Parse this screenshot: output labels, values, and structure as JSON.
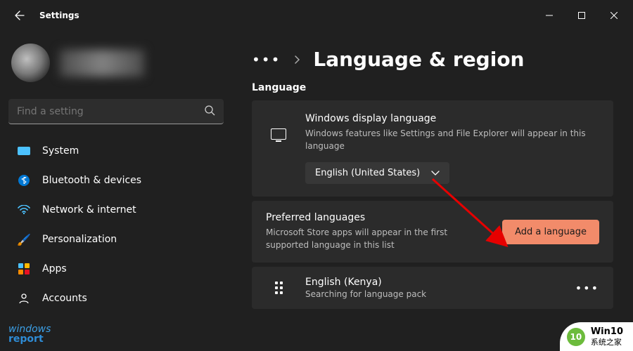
{
  "app_title": "Settings",
  "window_controls": {
    "min": "minimize",
    "max": "maximize",
    "close": "close"
  },
  "search": {
    "placeholder": "Find a setting"
  },
  "nav_items": [
    {
      "icon": "system",
      "label": "System"
    },
    {
      "icon": "bluetooth",
      "label": "Bluetooth & devices"
    },
    {
      "icon": "network",
      "label": "Network & internet"
    },
    {
      "icon": "personalization",
      "label": "Personalization"
    },
    {
      "icon": "apps",
      "label": "Apps"
    },
    {
      "icon": "accounts",
      "label": "Accounts"
    }
  ],
  "breadcrumb": {
    "more": "•••",
    "page_title": "Language & region"
  },
  "section": {
    "language_heading": "Language"
  },
  "display_language": {
    "title": "Windows display language",
    "subtitle": "Windows features like Settings and File Explorer will appear in this language",
    "selected": "English (United States)"
  },
  "preferred_languages": {
    "title": "Preferred languages",
    "subtitle": "Microsoft Store apps will appear in the first supported language in this list",
    "add_label": "Add a language"
  },
  "language_entry": {
    "title": "English (Kenya)",
    "subtitle": "Searching for language pack"
  },
  "watermarks": {
    "wr_line1": "windows",
    "wr_line2": "report",
    "wz_line1": "Win10",
    "wz_line2": "系统之家",
    "wz_badge": "10"
  }
}
